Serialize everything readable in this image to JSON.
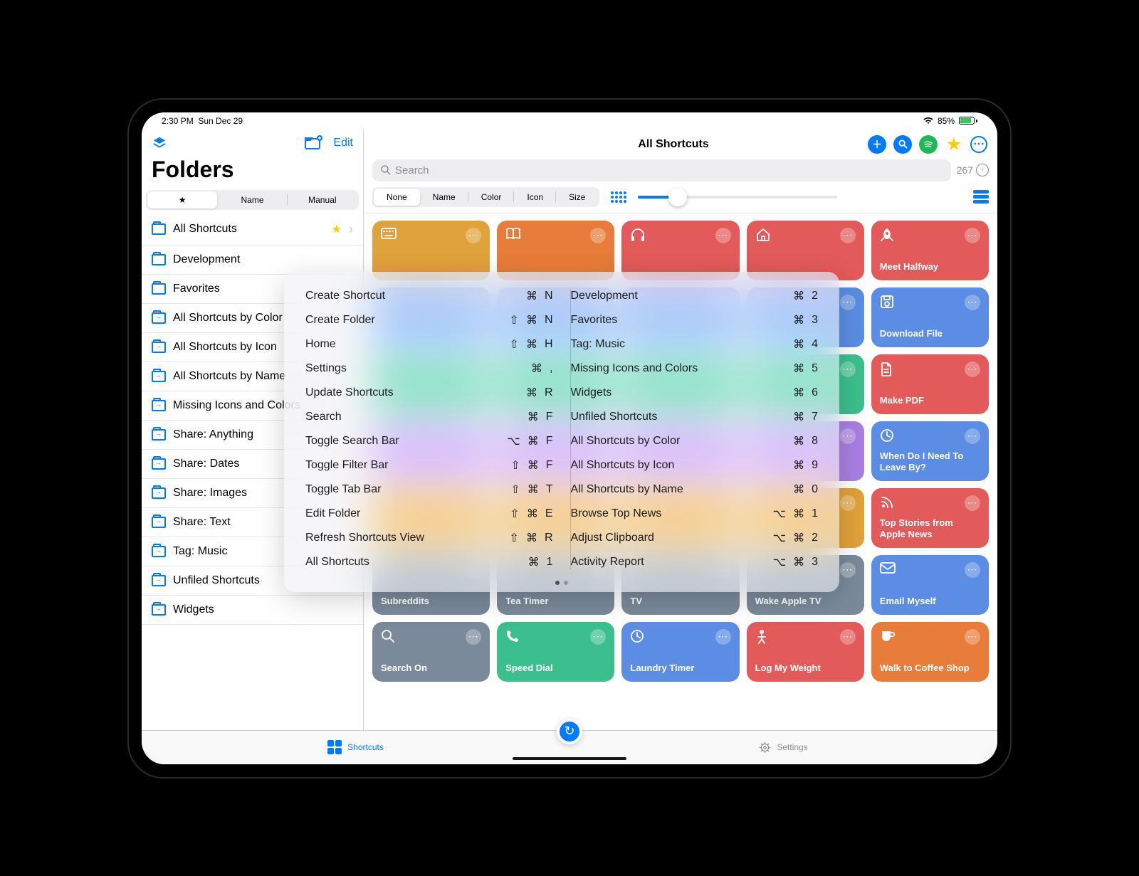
{
  "status": {
    "time": "2:30 PM",
    "date": "Sun Dec 29",
    "battery": "85%"
  },
  "sidebar": {
    "title": "Folders",
    "edit": "Edit",
    "segments": [
      "★",
      "Name",
      "Manual"
    ],
    "items": [
      {
        "label": "All Shortcuts",
        "smart": false,
        "fav": true,
        "chevron": true
      },
      {
        "label": "Development",
        "smart": false
      },
      {
        "label": "Favorites",
        "smart": false
      },
      {
        "label": "All Shortcuts by Color",
        "smart": true
      },
      {
        "label": "All Shortcuts by Icon",
        "smart": true
      },
      {
        "label": "All Shortcuts by Name",
        "smart": true
      },
      {
        "label": "Missing Icons and Colors",
        "smart": true
      },
      {
        "label": "Share: Anything",
        "smart": true
      },
      {
        "label": "Share: Dates",
        "smart": true
      },
      {
        "label": "Share: Images",
        "smart": true
      },
      {
        "label": "Share: Text",
        "smart": true
      },
      {
        "label": "Tag: Music",
        "smart": true
      },
      {
        "label": "Unfiled Shortcuts",
        "smart": true
      },
      {
        "label": "Widgets",
        "smart": true
      }
    ]
  },
  "main": {
    "title": "All Shortcuts",
    "search_placeholder": "Search",
    "count": "267",
    "sort_segments": [
      "None",
      "Name",
      "Color",
      "Icon",
      "Size"
    ]
  },
  "tiles": [
    {
      "label": "",
      "color": "#e0a23a",
      "icon": "keyboard"
    },
    {
      "label": "",
      "color": "#e87c3a",
      "icon": "book"
    },
    {
      "label": "",
      "color": "#e35a5a",
      "icon": "headphones"
    },
    {
      "label": "",
      "color": "#e35a5a",
      "icon": "home"
    },
    {
      "label": "Meet Halfway",
      "color": "#e35a5a",
      "icon": "rocket"
    },
    {
      "label": "",
      "color": "#5a8de3",
      "icon": ""
    },
    {
      "label": "",
      "color": "#5a8de3",
      "icon": ""
    },
    {
      "label": "",
      "color": "#5a8de3",
      "icon": ""
    },
    {
      "label": "",
      "color": "#5a8de3",
      "icon": ""
    },
    {
      "label": "Download File",
      "color": "#5a8de3",
      "icon": "disk"
    },
    {
      "label": "",
      "color": "#3cbf8f",
      "icon": ""
    },
    {
      "label": "",
      "color": "#3cbf8f",
      "icon": ""
    },
    {
      "label": "",
      "color": "#3cbf8f",
      "icon": ""
    },
    {
      "label": "",
      "color": "#3cbf8f",
      "icon": ""
    },
    {
      "label": "Make PDF",
      "color": "#e35a5a",
      "icon": "document"
    },
    {
      "label": "",
      "color": "#a97fe0",
      "icon": ""
    },
    {
      "label": "",
      "color": "#a97fe0",
      "icon": ""
    },
    {
      "label": "",
      "color": "#a97fe0",
      "icon": ""
    },
    {
      "label": "",
      "color": "#a97fe0",
      "icon": ""
    },
    {
      "label": "When Do I Need To Leave By?",
      "color": "#5a8de3",
      "icon": "clock"
    },
    {
      "label": "",
      "color": "#e0a23a",
      "icon": ""
    },
    {
      "label": "",
      "color": "#e0a23a",
      "icon": ""
    },
    {
      "label": "",
      "color": "#e0a23a",
      "icon": ""
    },
    {
      "label": "",
      "color": "#e0a23a",
      "icon": ""
    },
    {
      "label": "Top Stories from Apple News",
      "color": "#e35a5a",
      "icon": "rss"
    },
    {
      "label": "Subreddits",
      "color": "#7a8a9a",
      "icon": ""
    },
    {
      "label": "Tea Timer",
      "color": "#7a8a9a",
      "icon": ""
    },
    {
      "label": "TV",
      "color": "#7a8a9a",
      "icon": ""
    },
    {
      "label": "Wake Apple TV",
      "color": "#7a8a9a",
      "icon": ""
    },
    {
      "label": "Email Myself",
      "color": "#5a8de3",
      "icon": "mail"
    },
    {
      "label": "Search On",
      "color": "#7a8a9a",
      "icon": "search"
    },
    {
      "label": "Speed Dial",
      "color": "#3cbf8f",
      "icon": "phone"
    },
    {
      "label": "Laundry Timer",
      "color": "#5a8de3",
      "icon": "clock"
    },
    {
      "label": "Log My Weight",
      "color": "#e35a5a",
      "icon": "person"
    },
    {
      "label": "Walk to Coffee Shop",
      "color": "#e87c3a",
      "icon": "coffee"
    }
  ],
  "tabs": {
    "shortcuts": "Shortcuts",
    "settings": "Settings"
  },
  "kb": {
    "left": [
      {
        "label": "Create Shortcut",
        "keys": [
          "⌘",
          "N"
        ]
      },
      {
        "label": "Create Folder",
        "keys": [
          "⇧",
          "⌘",
          "N"
        ]
      },
      {
        "label": "Home",
        "keys": [
          "⇧",
          "⌘",
          "H"
        ]
      },
      {
        "label": "Settings",
        "keys": [
          "⌘",
          ","
        ]
      },
      {
        "label": "Update Shortcuts",
        "keys": [
          "⌘",
          "R"
        ]
      },
      {
        "label": "Search",
        "keys": [
          "⌘",
          "F"
        ]
      },
      {
        "label": "Toggle Search Bar",
        "keys": [
          "⌥",
          "⌘",
          "F"
        ]
      },
      {
        "label": "Toggle Filter Bar",
        "keys": [
          "⇧",
          "⌘",
          "F"
        ]
      },
      {
        "label": "Toggle Tab Bar",
        "keys": [
          "⇧",
          "⌘",
          "T"
        ]
      },
      {
        "label": "Edit Folder",
        "keys": [
          "⇧",
          "⌘",
          "E"
        ]
      },
      {
        "label": "Refresh Shortcuts View",
        "keys": [
          "⇧",
          "⌘",
          "R"
        ]
      },
      {
        "label": "All Shortcuts",
        "keys": [
          "⌘",
          "1"
        ]
      }
    ],
    "right": [
      {
        "label": "Development",
        "keys": [
          "⌘",
          "2"
        ]
      },
      {
        "label": "Favorites",
        "keys": [
          "⌘",
          "3"
        ]
      },
      {
        "label": "Tag: Music",
        "keys": [
          "⌘",
          "4"
        ]
      },
      {
        "label": "Missing Icons and Colors",
        "keys": [
          "⌘",
          "5"
        ]
      },
      {
        "label": "Widgets",
        "keys": [
          "⌘",
          "6"
        ]
      },
      {
        "label": "Unfiled Shortcuts",
        "keys": [
          "⌘",
          "7"
        ]
      },
      {
        "label": "All Shortcuts by Color",
        "keys": [
          "⌘",
          "8"
        ]
      },
      {
        "label": "All Shortcuts by Icon",
        "keys": [
          "⌘",
          "9"
        ]
      },
      {
        "label": "All Shortcuts by Name",
        "keys": [
          "⌘",
          "0"
        ]
      },
      {
        "label": "Browse Top News",
        "keys": [
          "⌥",
          "⌘",
          "1"
        ]
      },
      {
        "label": "Adjust Clipboard",
        "keys": [
          "⌥",
          "⌘",
          "2"
        ]
      },
      {
        "label": "Activity Report",
        "keys": [
          "⌥",
          "⌘",
          "3"
        ]
      }
    ]
  }
}
